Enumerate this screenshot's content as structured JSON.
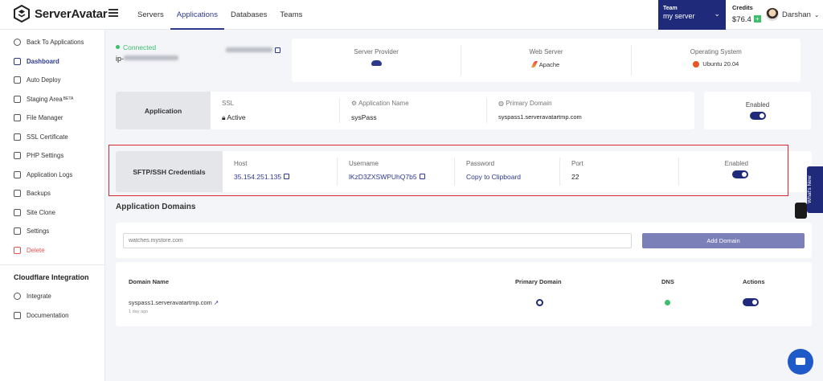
{
  "brand": {
    "name": "ServerAvatar"
  },
  "nav": {
    "items": [
      "Servers",
      "Applications",
      "Databases",
      "Teams"
    ],
    "active": "Applications"
  },
  "team": {
    "label": "Team",
    "value": "my server"
  },
  "credits": {
    "label": "Credits",
    "value": "$76.4"
  },
  "user": {
    "name": "Darshan"
  },
  "sidebar": {
    "items": [
      {
        "label": "Back To Applications",
        "icon": "back-arrow-icon"
      },
      {
        "label": "Dashboard",
        "icon": "dashboard-icon",
        "active": true
      },
      {
        "label": "Auto Deploy",
        "icon": "auto-deploy-icon"
      },
      {
        "label": "Staging Area",
        "badge": "BETA",
        "icon": "staging-icon"
      },
      {
        "label": "File Manager",
        "icon": "file-icon"
      },
      {
        "label": "SSL Certificate",
        "icon": "lock-icon"
      },
      {
        "label": "PHP Settings",
        "icon": "gear-icon"
      },
      {
        "label": "Application Logs",
        "icon": "logs-icon"
      },
      {
        "label": "Backups",
        "icon": "backup-icon"
      },
      {
        "label": "Site Clone",
        "icon": "clone-icon"
      },
      {
        "label": "Settings",
        "icon": "settings-icon"
      },
      {
        "label": "Delete",
        "icon": "trash-icon",
        "danger": true
      }
    ],
    "cloudflare_heading": "Cloudflare Integration",
    "cloudflare_items": [
      {
        "label": "Integrate",
        "icon": "cloud-icon"
      },
      {
        "label": "Documentation",
        "icon": "doc-icon"
      }
    ]
  },
  "server": {
    "status": "Connected",
    "ip_prefix": "ip-"
  },
  "info": {
    "provider_label": "Server Provider",
    "webserver_label": "Web Server",
    "webserver_value": "Apache",
    "os_label": "Operating System",
    "os_value": "Ubuntu 20.04"
  },
  "application": {
    "label": "Application",
    "ssl_label": "SSL",
    "ssl_value": "Active",
    "name_label": "Application Name",
    "name_value": "sysPass",
    "domain_label": "Primary Domain",
    "domain_value": "syspass1.serveravatartmp.com",
    "enabled_label": "Enabled"
  },
  "sftp": {
    "label": "SFTP/SSH Credentials",
    "host_label": "Host",
    "host_value": "35.154.251.135",
    "username_label": "Username",
    "username_value": "lKzD3ZXSWPUhQ7b5",
    "password_label": "Password",
    "password_value": "Copy to Clipboard",
    "port_label": "Port",
    "port_value": "22",
    "enabled_label": "Enabled"
  },
  "domains": {
    "title": "Application Domains",
    "input_placeholder": "watches.mystore.com",
    "add_button": "Add Domain",
    "columns": [
      "Domain Name",
      "Primary Domain",
      "DNS",
      "Actions"
    ],
    "rows": [
      {
        "domain": "syspass1.serveravatartmp.com",
        "age": "1 day ago"
      }
    ]
  },
  "whats_new": "What's New",
  "colors": {
    "primary": "#1f2a7a",
    "success": "#3bbf6b",
    "danger": "#e0534d",
    "highlight": "#d9282f"
  }
}
